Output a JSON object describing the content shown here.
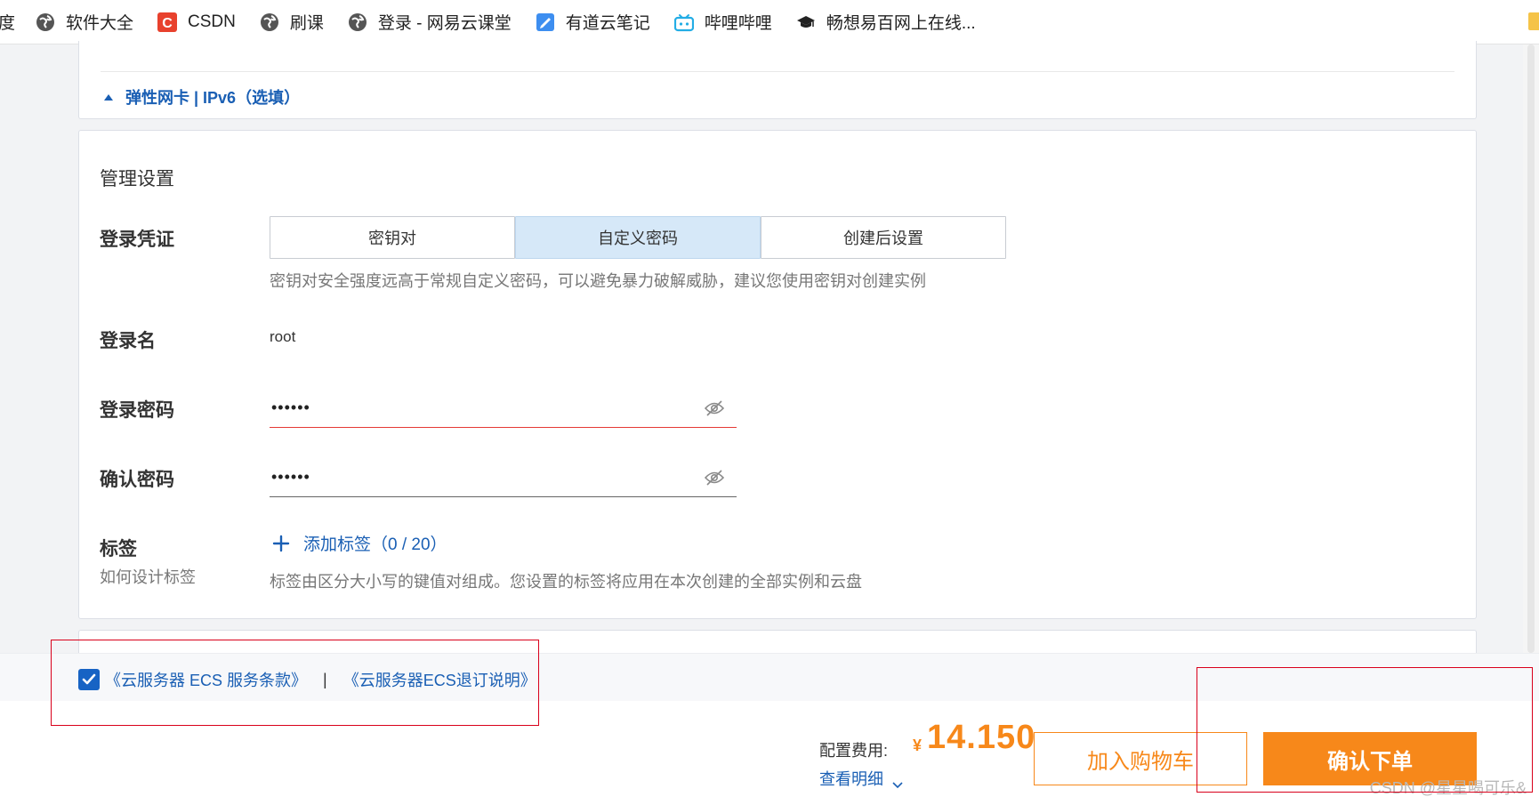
{
  "bookmarks": {
    "items": [
      {
        "label": "度"
      },
      {
        "label": "软件大全",
        "icon": "globe-icon"
      },
      {
        "label": "CSDN",
        "icon": "csdn-icon",
        "icon_text": "C",
        "color": "#e8412d"
      },
      {
        "label": "刷课",
        "icon": "globe-icon"
      },
      {
        "label": "登录 - 网易云课堂",
        "icon": "globe-icon"
      },
      {
        "label": "有道云笔记",
        "icon": "note-icon",
        "color": "#3d8ef0"
      },
      {
        "label": "哔哩哔哩",
        "icon": "bilibili-icon",
        "color": "#23ade5"
      },
      {
        "label": "畅想易百网上在线...",
        "icon": "graduation-cap-icon"
      }
    ]
  },
  "network": {
    "link_label": "弹性网卡 | IPv6（选填）"
  },
  "management": {
    "title": "管理设置",
    "credential": {
      "label": "登录凭证",
      "options": [
        "密钥对",
        "自定义密码",
        "创建后设置"
      ],
      "selected": "自定义密码",
      "hint": "密钥对安全强度远高于常规自定义密码，可以避免暴力破解威胁，建议您使用密钥对创建实例"
    },
    "login_name": {
      "label": "登录名",
      "value": "root"
    },
    "password": {
      "label": "登录密码",
      "value": "••••••"
    },
    "confirm_password": {
      "label": "确认密码",
      "value": "••••••"
    },
    "tags": {
      "label": "标签",
      "sublabel": "如何设计标签",
      "add_label": "添加标签（0 / 20）",
      "hint": "标签由区分大小写的键值对组成。您设置的标签将应用在本次创建的全部实例和云盘"
    }
  },
  "agreement": {
    "checked": true,
    "terms_link": "《云服务器 ECS 服务条款》",
    "separator": "|",
    "refund_link": "《云服务器ECS退订说明》"
  },
  "footer": {
    "fee_label": "配置费用:",
    "currency": "¥",
    "price": "14.150",
    "detail_link": "查看明细",
    "cart_button": "加入购物车",
    "order_button": "确认下单",
    "watermark": "CSDN @星星喝可乐&"
  },
  "colors": {
    "accent": "#f7881a",
    "link": "#1a5fb4",
    "annotation": "#d9001b",
    "selected_bg": "#d6e8f8"
  }
}
